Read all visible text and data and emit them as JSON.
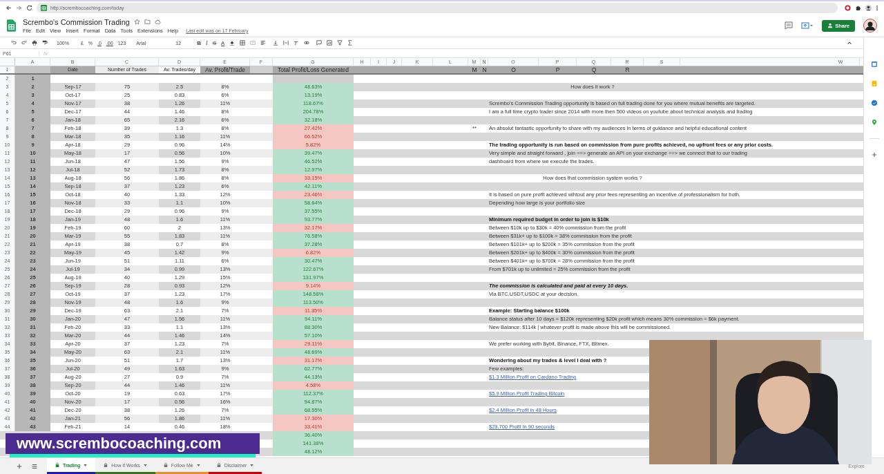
{
  "browser": {
    "url": "http://scrembocoaching.com/today"
  },
  "document": {
    "title": "Scrembo's Commission Trading",
    "menu": [
      "File",
      "Edit",
      "View",
      "Insert",
      "Format",
      "Data",
      "Tools",
      "Extensions",
      "Help"
    ],
    "last_edit": "Last edit was on 17 February",
    "share": "Share"
  },
  "toolbar": {
    "zoom": "100%",
    "currency": "£",
    "percent": "%",
    "decrease_decimals": ".0",
    "increase_decimals": ".00",
    "more_formats": "123",
    "font": "Arial",
    "font_size": "12",
    "bold": "B",
    "italic": "I",
    "strikethrough": "S",
    "text_color": "A"
  },
  "formula_bar": {
    "name_box": "P61",
    "label": "fx"
  },
  "column_letters": [
    "A",
    "B",
    "C",
    "D",
    "E",
    "F",
    "G",
    "H",
    "I",
    "J",
    "K",
    "L",
    "M",
    "N",
    "O",
    "P",
    "Q",
    "R",
    "S",
    "W"
  ],
  "header_row": {
    "row": "1",
    "labels": [
      "Date",
      "Number of Trades",
      "Av. Trades/day",
      "Av. Profit/Trade",
      "Total Profit/Loss Generated"
    ],
    "letters": [
      "M",
      "N",
      "O",
      "P",
      "Q",
      "R"
    ]
  },
  "rows": [
    {
      "row": "2",
      "index": "1"
    },
    {
      "row": "3",
      "index": "2",
      "date": "Sep-17",
      "trades": "75",
      "per_day": "2.5",
      "avg": "8%",
      "total": "48.63%",
      "profit": true,
      "note": {
        "kind": "heading",
        "text": "How does it work ?"
      }
    },
    {
      "row": "4",
      "index": "3",
      "date": "Oct-17",
      "trades": "25",
      "per_day": "0.83",
      "avg": "6%",
      "total": "13.19%",
      "profit": true
    },
    {
      "row": "5",
      "index": "4",
      "date": "Nov-17",
      "trades": "38",
      "per_day": "1.26",
      "avg": "11%",
      "total": "118.67%",
      "profit": true,
      "note": {
        "kind": "text",
        "text": "Scrembo's Commission Trading opportunity is based on full trading done for you where mutual benefits are targeted."
      }
    },
    {
      "row": "6",
      "index": "5",
      "date": "Dec-17",
      "trades": "44",
      "per_day": "1.46",
      "avg": "8%",
      "total": "204.78%",
      "profit": true,
      "note": {
        "kind": "text",
        "text": "I am a full time crypto trader since 2014 with more then 500 videos on youtube about technical analysis and trading"
      }
    },
    {
      "row": "7",
      "index": "6",
      "date": "Jan-18",
      "trades": "65",
      "per_day": "2.16",
      "avg": "6%",
      "total": "32.18%",
      "profit": true
    },
    {
      "row": "8",
      "index": "7",
      "date": "Feb-18",
      "trades": "39",
      "per_day": "1.3",
      "avg": "8%",
      "total": "27.42%",
      "profit": false,
      "marker": "**",
      "note": {
        "kind": "text",
        "text": "An absolut fantastic opportunity to share with my audiences in terms of guidance and helpful educational content"
      }
    },
    {
      "row": "9",
      "index": "8",
      "date": "Mar-18",
      "trades": "35",
      "per_day": "1.16",
      "avg": "11%",
      "total": "66.52%",
      "profit": false
    },
    {
      "row": "10",
      "index": "9",
      "date": "Apr-18",
      "trades": "29",
      "per_day": "0.96",
      "avg": "14%",
      "total": "5.82%",
      "profit": false,
      "note": {
        "kind": "bold",
        "text": "The trading opportunity is run based on commission from pure profits achieved, no upfront fees or any prior costs."
      }
    },
    {
      "row": "11",
      "index": "10",
      "date": "May-18",
      "trades": "17",
      "per_day": "0.56",
      "avg": "10%",
      "total": "39.47%",
      "profit": true,
      "note": {
        "kind": "text",
        "text": "Very simple and straight forward , join ==> generate an API on your exchange ==> we connect that to our trading"
      }
    },
    {
      "row": "12",
      "index": "11",
      "date": "Jun-18",
      "trades": "47",
      "per_day": "1.56",
      "avg": "9%",
      "total": "46.52%",
      "profit": true,
      "note": {
        "kind": "text",
        "text": "dashboard from where we execute the trades."
      }
    },
    {
      "row": "13",
      "index": "12",
      "date": "Jul-18",
      "trades": "52",
      "per_day": "1.73",
      "avg": "8%",
      "total": "12.97%",
      "profit": true
    },
    {
      "row": "14",
      "index": "13",
      "date": "Aug-18",
      "trades": "56",
      "per_day": "1.86",
      "avg": "8%",
      "total": "33.15%",
      "profit": false,
      "note": {
        "kind": "heading",
        "text": "How does that commission system works ?"
      }
    },
    {
      "row": "15",
      "index": "14",
      "date": "Sep-18",
      "trades": "37",
      "per_day": "1.23",
      "avg": "6%",
      "total": "42.11%",
      "profit": true
    },
    {
      "row": "16",
      "index": "15",
      "date": "Oct-18",
      "trades": "40",
      "per_day": "1.33",
      "avg": "12%",
      "total": "23.46%",
      "profit": false,
      "note": {
        "kind": "text",
        "text": "It is based on pure profit achieved wihtout any prior fees representing an incentive of professionalism for both."
      }
    },
    {
      "row": "17",
      "index": "16",
      "date": "Nov-18",
      "trades": "33",
      "per_day": "1.1",
      "avg": "10%",
      "total": "58.64%",
      "profit": true,
      "note": {
        "kind": "text",
        "text": "Depending how large is your portfolio size"
      }
    },
    {
      "row": "18",
      "index": "17",
      "date": "Dec-18",
      "trades": "29",
      "per_day": "0.96",
      "avg": "9%",
      "total": "37.55%",
      "profit": true
    },
    {
      "row": "19",
      "index": "18",
      "date": "Jan-19",
      "trades": "48",
      "per_day": "1.6",
      "avg": "11%",
      "total": "93.77%",
      "profit": true,
      "note": {
        "kind": "bold",
        "text": "Minimum required budget in order to join is $10k"
      }
    },
    {
      "row": "20",
      "index": "19",
      "date": "Feb-19",
      "trades": "60",
      "per_day": "2",
      "avg": "13%",
      "total": "32.17%",
      "profit": false,
      "note": {
        "kind": "text",
        "text": "Between $10k up to $30k = 40% commission from the profit"
      }
    },
    {
      "row": "21",
      "index": "20",
      "date": "Mar-19",
      "trades": "55",
      "per_day": "1.83",
      "avg": "11%",
      "total": "76.58%",
      "profit": true,
      "note": {
        "kind": "text",
        "text": "Between $31k+ up to $100k = 38% commission from the profit"
      }
    },
    {
      "row": "22",
      "index": "21",
      "date": "Apr-19",
      "trades": "38",
      "per_day": "0.7",
      "avg": "8%",
      "total": "37.28%",
      "profit": true,
      "note": {
        "kind": "text",
        "text": "Between $101k+ up to $200k = 35% commission from the profit"
      }
    },
    {
      "row": "23",
      "index": "22",
      "date": "May-19",
      "trades": "45",
      "per_day": "1.42",
      "avg": "9%",
      "total": "6.82%",
      "profit": false,
      "note": {
        "kind": "text",
        "text": "Between $201k+ up to $400k = 30% commission from the profit"
      }
    },
    {
      "row": "24",
      "index": "23",
      "date": "Jun-19",
      "trades": "51",
      "per_day": "1.11",
      "avg": "6%",
      "total": "30.47%",
      "profit": true,
      "note": {
        "kind": "text",
        "text": "Between $401k+ up to $700k = 28% commission from the profit"
      }
    },
    {
      "row": "25",
      "index": "24",
      "date": "Jul-19",
      "trades": "34",
      "per_day": "0.99",
      "avg": "13%",
      "total": "122.67%",
      "profit": true,
      "note": {
        "kind": "text",
        "text": "From $701k up to unlimited = 25% commission from the profit"
      }
    },
    {
      "row": "26",
      "index": "25",
      "date": "Aug-19",
      "trades": "40",
      "per_day": "1.29",
      "avg": "15%",
      "total": "131.97%",
      "profit": true
    },
    {
      "row": "27",
      "index": "26",
      "date": "Sep-19",
      "trades": "28",
      "per_day": "0.93",
      "avg": "12%",
      "total": "9.14%",
      "profit": false,
      "note": {
        "kind": "bold_italic",
        "text": "The commission is calculated and paid at every 10 days."
      }
    },
    {
      "row": "28",
      "index": "27",
      "date": "Oct-19",
      "trades": "37",
      "per_day": "1.23",
      "avg": "17%",
      "total": "148.58%",
      "profit": true,
      "note": {
        "kind": "text",
        "text": "Via BTC,USDT,USDC at your decision."
      }
    },
    {
      "row": "29",
      "index": "28",
      "date": "Nov-19",
      "trades": "48",
      "per_day": "1.6",
      "avg": "9%",
      "total": "113.50%",
      "profit": true
    },
    {
      "row": "30",
      "index": "29",
      "date": "Dec-19",
      "trades": "63",
      "per_day": "2.1",
      "avg": "7%",
      "total": "11.35%",
      "profit": false,
      "note": {
        "kind": "bold",
        "text": "Example: Starting balance $100k"
      }
    },
    {
      "row": "31",
      "index": "30",
      "date": "Jan-20",
      "trades": "47",
      "per_day": "1.56",
      "avg": "11%",
      "total": "94.11%",
      "profit": true,
      "note": {
        "kind": "text",
        "text": "Balance status after 10 days = $120k representing $20k profit which means 30% commission = $6k payment."
      }
    },
    {
      "row": "32",
      "index": "31",
      "date": "Feb-20",
      "trades": "33",
      "per_day": "1.1",
      "avg": "13%",
      "total": "88.30%",
      "profit": true,
      "note": {
        "kind": "text",
        "text": "New Balance: $114k | whatever profit is made above this will be commissioned."
      }
    },
    {
      "row": "33",
      "index": "32",
      "date": "Mar-20",
      "trades": "44",
      "per_day": "1.46",
      "avg": "14%",
      "total": "57.10%",
      "profit": true
    },
    {
      "row": "34",
      "index": "33",
      "date": "Apr-20",
      "trades": "37",
      "per_day": "1.23",
      "avg": "7%",
      "total": "29.11%",
      "profit": false,
      "note": {
        "kind": "text",
        "text": "We prefer working with Bybit, Binance, FTX,  Bitmex."
      }
    },
    {
      "row": "35",
      "index": "34",
      "date": "May-20",
      "trades": "63",
      "per_day": "2.1",
      "avg": "11%",
      "total": "48.69%",
      "profit": true
    },
    {
      "row": "36",
      "index": "35",
      "date": "Jun-20",
      "trades": "51",
      "per_day": "1.7",
      "avg": "13%",
      "total": "31.17%",
      "profit": false,
      "note": {
        "kind": "bold",
        "text": "Wondering about my trades & level I deal with ?"
      }
    },
    {
      "row": "37",
      "index": "36",
      "date": "Jul-20",
      "trades": "49",
      "per_day": "1.63",
      "avg": "9%",
      "total": "62.77%",
      "profit": true,
      "note": {
        "kind": "text",
        "text": "Few examples:"
      }
    },
    {
      "row": "38",
      "index": "37",
      "date": "Aug-20",
      "trades": "27",
      "per_day": "0.9",
      "avg": "7%",
      "total": "44.13%",
      "profit": true,
      "note": {
        "kind": "link",
        "text": "$1.3 Million Profit on Cardano Trading"
      }
    },
    {
      "row": "39",
      "index": "38",
      "date": "Sep-20",
      "trades": "44",
      "per_day": "1.46",
      "avg": "11%",
      "total": "4.58%",
      "profit": false
    },
    {
      "row": "40",
      "index": "39",
      "date": "Oct-20",
      "trades": "19",
      "per_day": "0.63",
      "avg": "17%",
      "total": "112.37%",
      "profit": true,
      "note": {
        "kind": "link",
        "text": "$5.9 Million Profit Trading Bitcoin"
      }
    },
    {
      "row": "41",
      "index": "40",
      "date": "Nov-20",
      "trades": "17",
      "per_day": "0.56",
      "avg": "16%",
      "total": "94.87%",
      "profit": true
    },
    {
      "row": "42",
      "index": "41",
      "date": "Dec-20",
      "trades": "38",
      "per_day": "1.26",
      "avg": "7%",
      "total": "68.55%",
      "profit": true,
      "note": {
        "kind": "link",
        "text": "$2.4 Million Profit in 48 Hours"
      }
    },
    {
      "row": "43",
      "index": "42",
      "date": "Jan-21",
      "trades": "56",
      "per_day": "1.86",
      "avg": "11%",
      "total": "17.30%",
      "profit": false
    },
    {
      "row": "44",
      "index": "43",
      "date": "Feb-21",
      "trades": "14",
      "per_day": "0.46",
      "avg": "18%",
      "total": "33.41%",
      "profit": false,
      "note": {
        "kind": "link",
        "text": "$29,700 Profit in 90 seconds"
      }
    },
    {
      "total": "36.40%",
      "profit": true
    },
    {
      "total": "141.38%",
      "profit": true
    },
    {
      "total": "48.12%",
      "profit": true
    }
  ],
  "sheet_tabs": [
    {
      "label": "Trading",
      "selected": true,
      "color": "#1a1ab8"
    },
    {
      "label": "How It Works",
      "selected": false,
      "color": "#38761d"
    },
    {
      "label": "Follow Me",
      "selected": false,
      "color": "#e69138"
    },
    {
      "label": "Disclaimer",
      "selected": false,
      "color": "#cc0000"
    }
  ],
  "explore": "Explore",
  "overlay_banner": {
    "text": "www.scrembocoaching.com"
  }
}
